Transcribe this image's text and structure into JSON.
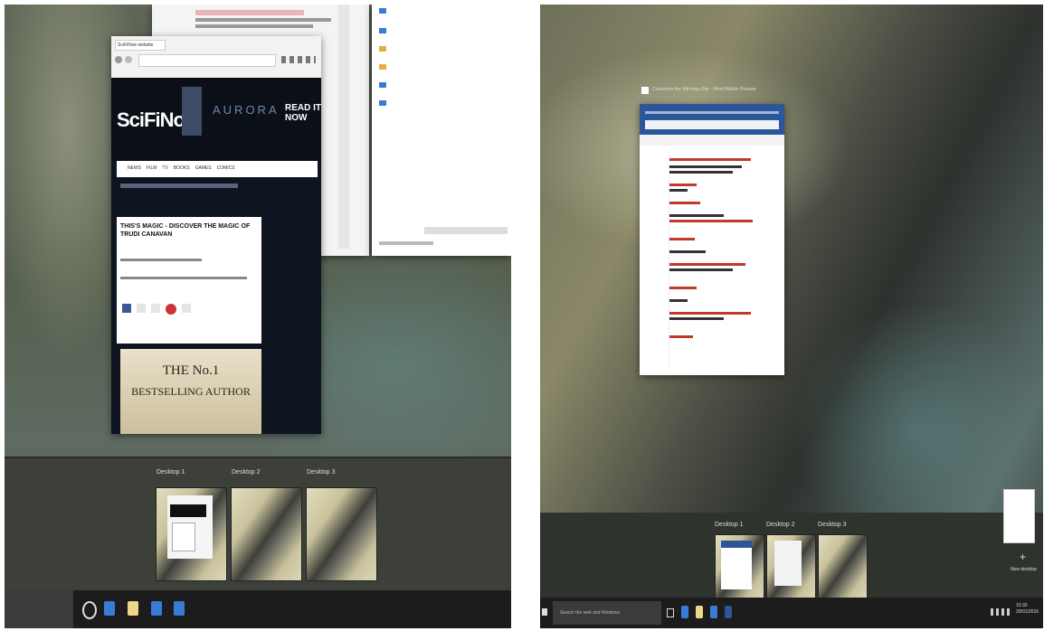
{
  "left": {
    "browser": {
      "tab_title": "SciFiNow website",
      "site_name": "SciFiNow",
      "banner_text": "AURORA",
      "banner_cta": "READ IT NOW",
      "nav_items": [
        "NEWS",
        "FILM",
        "TV",
        "BOOKS",
        "GAMES",
        "COMICS"
      ],
      "headline": "THIS'S MAGIC - DISCOVER THE MAGIC OF TRUDI CANAVAN",
      "ad_line1": "THE No.1",
      "ad_line2": "BESTSELLING AUTHOR"
    },
    "desktops": [
      {
        "label": "Desktop 1"
      },
      {
        "label": "Desktop 2"
      },
      {
        "label": "Desktop 3"
      }
    ]
  },
  "right": {
    "window_title": "Customize the Windows Bar - Word Mobile Preview",
    "desktops": [
      {
        "label": "Desktop 1"
      },
      {
        "label": "Desktop 2"
      },
      {
        "label": "Desktop 3"
      }
    ],
    "search_placeholder": "Search the web and Windows",
    "new_desktop_label": "New desktop",
    "clock_time": "10:30",
    "clock_date": "29/01/2015"
  },
  "colors": {
    "word_blue": "#2b579a",
    "taskbar_blue": "#3a7bd5"
  }
}
